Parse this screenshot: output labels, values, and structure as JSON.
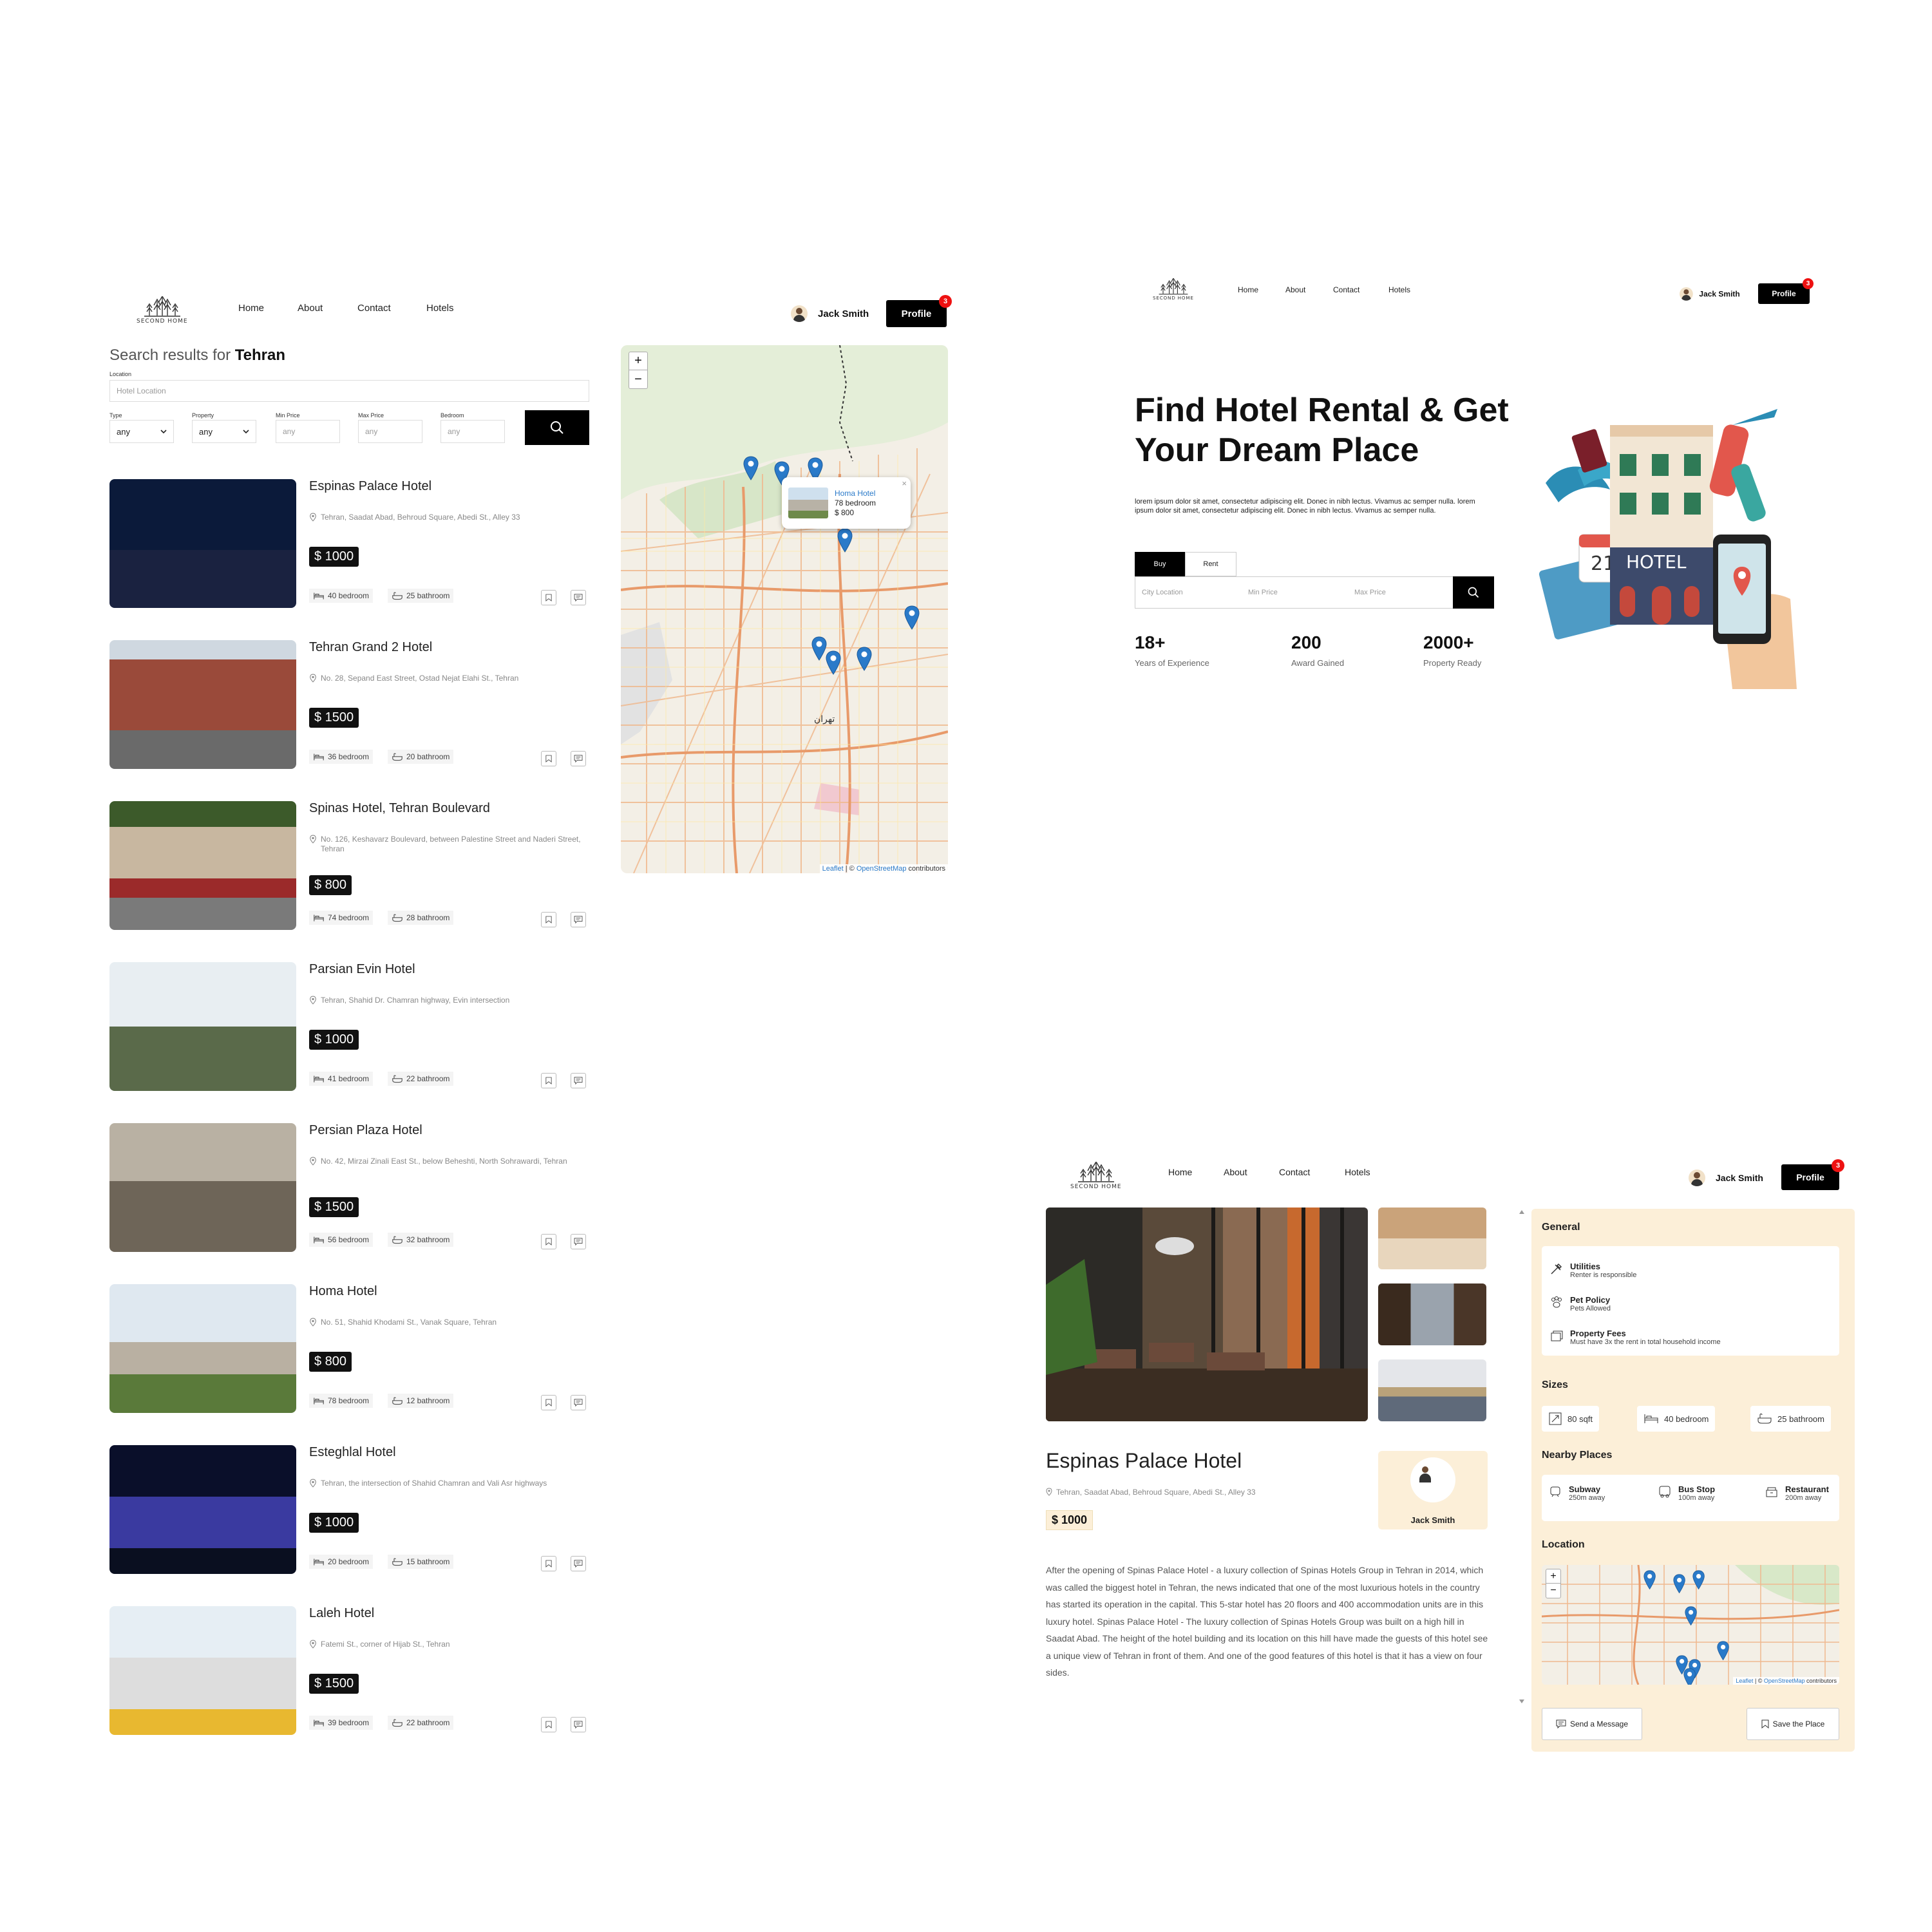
{
  "brand": {
    "logo_text": "SECOND HOME"
  },
  "nav": {
    "home": "Home",
    "about": "About",
    "contact": "Contact",
    "hotels": "Hotels"
  },
  "user": {
    "name": "Jack Smith",
    "profile_label": "Profile",
    "notifications": "3"
  },
  "search": {
    "title_prefix": "Search results for",
    "city": "Tehran",
    "location_label": "Location",
    "location_placeholder": "Hotel Location",
    "type_label": "Type",
    "type_value": "any",
    "property_label": "Property",
    "property_value": "any",
    "min_price_label": "Min Price",
    "min_price_placeholder": "any",
    "max_price_label": "Max Price",
    "max_price_placeholder": "any",
    "bedroom_label": "Bedroom",
    "bedroom_placeholder": "any"
  },
  "hotels": [
    {
      "name": "Espinas Palace Hotel",
      "address": "Tehran, Saadat Abad, Behroud Square, Abedi St., Alley 33",
      "price": "$ 1000",
      "bedrooms": "40 bedroom",
      "bathrooms": "25 bathroom"
    },
    {
      "name": "Tehran Grand 2 Hotel",
      "address": "No. 28, Sepand East Street, Ostad Nejat Elahi St., Tehran",
      "price": "$ 1500",
      "bedrooms": "36 bedroom",
      "bathrooms": "20 bathroom"
    },
    {
      "name": "Spinas Hotel, Tehran Boulevard",
      "address": "No. 126, Keshavarz Boulevard, between Palestine Street and Naderi Street, Tehran",
      "price": "$ 800",
      "bedrooms": "74 bedroom",
      "bathrooms": "28 bathroom"
    },
    {
      "name": "Parsian Evin Hotel",
      "address": "Tehran, Shahid Dr. Chamran highway, Evin intersection",
      "price": "$ 1000",
      "bedrooms": "41 bedroom",
      "bathrooms": "22 bathroom"
    },
    {
      "name": "Persian Plaza Hotel",
      "address": "No. 42, Mirzai Zinali East St., below Beheshti, North Sohrawardi, Tehran",
      "price": "$ 1500",
      "bedrooms": "56 bedroom",
      "bathrooms": "32 bathroom"
    },
    {
      "name": "Homa Hotel",
      "address": "No. 51, Shahid Khodami St., Vanak Square, Tehran",
      "price": "$ 800",
      "bedrooms": "78 bedroom",
      "bathrooms": "12 bathroom"
    },
    {
      "name": "Esteghlal Hotel",
      "address": "Tehran, the intersection of Shahid Chamran and Vali Asr highways",
      "price": "$ 1000",
      "bedrooms": "20 bedroom",
      "bathrooms": "15 bathroom"
    },
    {
      "name": "Laleh Hotel",
      "address": "Fatemi St., corner of Hijab St., Tehran",
      "price": "$ 1500",
      "bedrooms": "39 bedroom",
      "bathrooms": "22 bathroom"
    }
  ],
  "map": {
    "zoom_in": "+",
    "zoom_out": "−",
    "attribution_leaflet": "Leaflet",
    "attribution_sep": " | © ",
    "attribution_osm": "OpenStreetMap",
    "attribution_tail": " contributors",
    "popup": {
      "name": "Homa Hotel",
      "bedrooms": "78 bedroom",
      "price": "$ 800"
    },
    "city_label": "تهران"
  },
  "home": {
    "title": "Find Hotel Rental & Get Your Dream Place",
    "description": "lorem ipsum dolor sit amet, consectetur adipiscing elit. Donec in nibh lectus. Vivamus ac semper nulla. lorem ipsum dolor sit amet, consectetur adipiscing elit. Donec in nibh lectus. Vivamus ac semper nulla.",
    "tab_buy": "Buy",
    "tab_rent": "Rent",
    "city_placeholder": "City Location",
    "min_placeholder": "Min Price",
    "max_placeholder": "Max Price",
    "stats": [
      {
        "value": "18+",
        "label": "Years of Experience"
      },
      {
        "value": "200",
        "label": "Award Gained"
      },
      {
        "value": "2000+",
        "label": "Property Ready"
      }
    ],
    "illustration": {
      "hotel_sign": "HOTEL",
      "calendar_day": "21"
    }
  },
  "detail": {
    "name": "Espinas Palace Hotel",
    "address": "Tehran, Saadat Abad, Behroud Square, Abedi St., Alley 33",
    "price": "$ 1000",
    "host": "Jack Smith",
    "description": "After the opening of Spinas Palace Hotel - a luxury collection of Spinas Hotels Group in Tehran in 2014, which was called the biggest hotel in Tehran, the news indicated that one of the most luxurious hotels in the country has started its operation in the capital. This 5-star hotel has 20 floors and 400 accommodation units are in this luxury hotel. Spinas Palace Hotel - The luxury collection of Spinas Hotels Group was built on a high hill in Saadat Abad. The height of the hotel building and its location on this hill have made the guests of this hotel see a unique view of Tehran in front of them. And one of the good features of this hotel is that it has a view on four sides.",
    "general_title": "General",
    "general": [
      {
        "title": "Utilities",
        "sub": "Renter is responsible"
      },
      {
        "title": "Pet Policy",
        "sub": "Pets Allowed"
      },
      {
        "title": "Property Fees",
        "sub": "Must have 3x the rent in total household income"
      }
    ],
    "sizes_title": "Sizes",
    "sizes": {
      "area": "80 sqft",
      "bedrooms": "40 bedroom",
      "bathrooms": "25 bathroom"
    },
    "nearby_title": "Nearby Places",
    "nearby": [
      {
        "title": "Subway",
        "sub": "250m away"
      },
      {
        "title": "Bus Stop",
        "sub": "100m away"
      },
      {
        "title": "Restaurant",
        "sub": "200m away"
      }
    ],
    "location_title": "Location",
    "send_message": "Send a Message",
    "save_place": "Save the Place"
  },
  "colors": {
    "accent": "#000000",
    "panel": "#fcefd8",
    "badge": "#e11111",
    "marker": "#2a7ac9",
    "road": "#f0a87a"
  }
}
